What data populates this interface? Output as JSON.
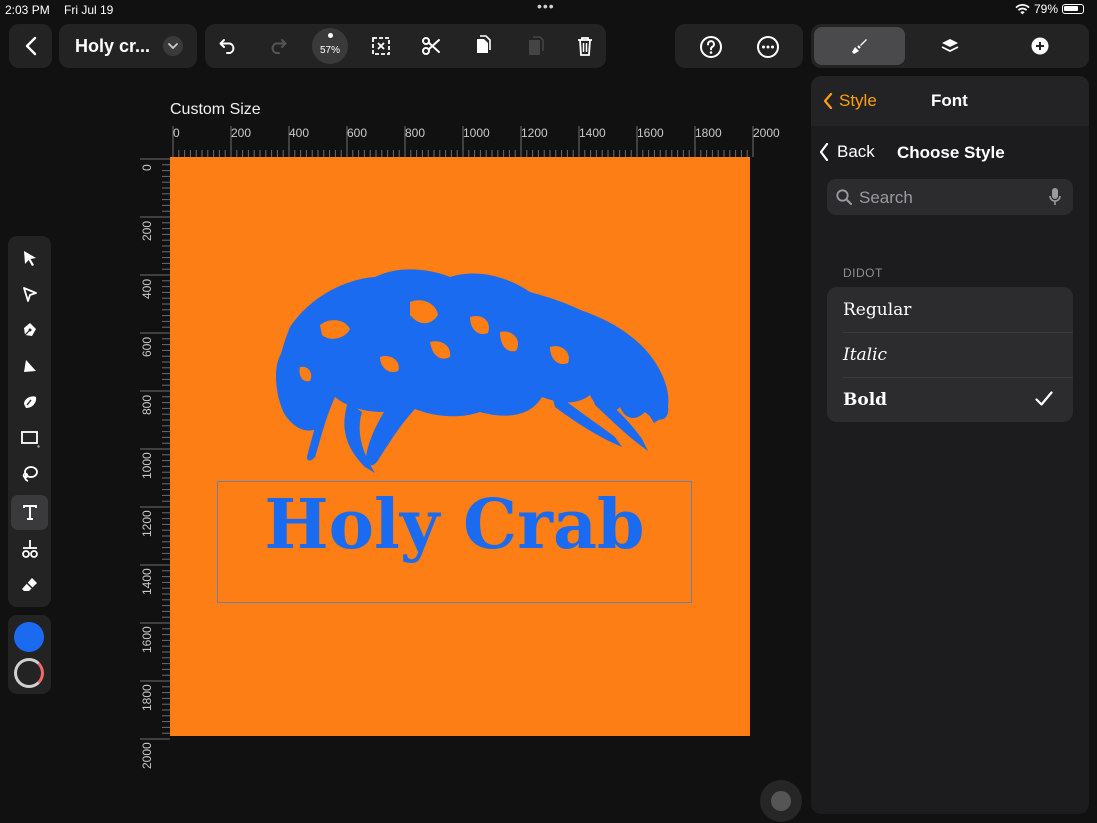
{
  "status": {
    "time": "2:03 PM",
    "date": "Fri Jul 19",
    "battery": "79%"
  },
  "toolbar": {
    "doc_title": "Holy cr...",
    "zoom": "57%",
    "panel_tabs": [
      "brush-tab",
      "layers-tab",
      "add-tab"
    ]
  },
  "panel": {
    "header_back": "Style",
    "header_title": "Font",
    "sub_back": "Back",
    "sub_title": "Choose Style",
    "search_placeholder": "Search",
    "section_label": "DIDOT",
    "styles": [
      {
        "label": "Regular",
        "selected": false
      },
      {
        "label": "Italic",
        "selected": false
      },
      {
        "label": "Bold",
        "selected": true
      }
    ]
  },
  "canvas": {
    "size_label": "Custom Size",
    "h_ruler": [
      "0",
      "200",
      "400",
      "600",
      "800",
      "1000",
      "1200",
      "1400",
      "1600",
      "1800",
      "2000"
    ],
    "v_ruler": [
      "0",
      "200",
      "400",
      "600",
      "800",
      "1000",
      "1200",
      "1400",
      "1600",
      "1800",
      "2000"
    ],
    "background_color": "#FD7E14",
    "art_color": "#1A6BF0",
    "headline": "Holy Crab"
  },
  "colors": {
    "stroke": "#1A6BF0",
    "accent": "#FF9F0A"
  }
}
